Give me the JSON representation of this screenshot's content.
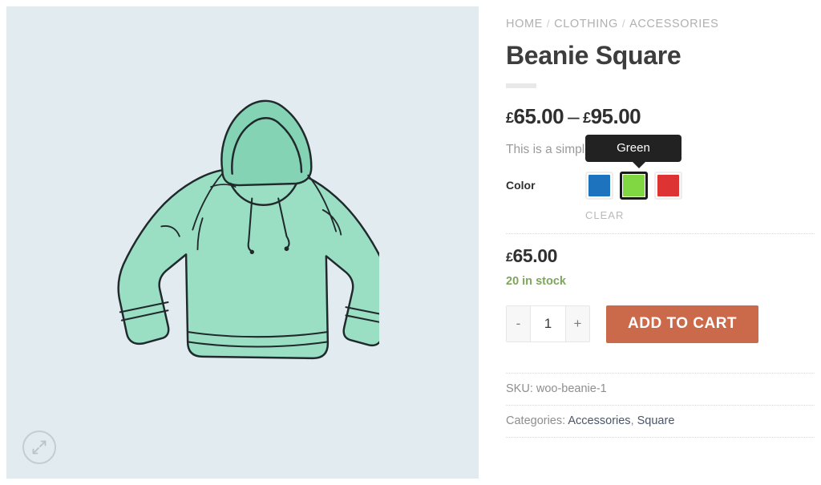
{
  "gallery": {
    "background_color": "#e1ebf0",
    "product_image_alt": "Green hoodie illustration",
    "zoom_button_name": "expand-image",
    "hoodie_fill_color": "#9adfc4",
    "hoodie_shade_color": "#84d3b5",
    "hoodie_outline_color": "#1f2a2a"
  },
  "breadcrumb": {
    "items": [
      {
        "label": "HOME"
      },
      {
        "label": "CLOTHING"
      },
      {
        "label": "ACCESSORIES"
      }
    ],
    "separator": "/"
  },
  "product": {
    "title": "Beanie Square",
    "price_range": {
      "currency": "£",
      "min": "65.00",
      "max": "95.00",
      "dash": "–"
    },
    "short_description": "This is a simple product.",
    "selected_price": {
      "currency": "£",
      "amount": "65.00"
    },
    "stock_status": "20 in stock",
    "stock_color": "#7ea55c"
  },
  "variations": {
    "attribute_label": "Color",
    "tooltip": "Green",
    "clear_label": "CLEAR",
    "swatches": [
      {
        "name": "Blue",
        "color": "#1e73be",
        "selected": false
      },
      {
        "name": "Green",
        "color": "#81d742",
        "selected": true
      },
      {
        "name": "Red",
        "color": "#dd3333",
        "selected": false
      }
    ]
  },
  "cart": {
    "quantity_value": "1",
    "decrement_label": "-",
    "increment_label": "+",
    "add_to_cart_label": "ADD TO CART",
    "button_color": "#cb6a4a"
  },
  "meta": {
    "sku_label": "SKU:",
    "sku_value": "woo-beanie-1",
    "categories_label": "Categories:",
    "categories": [
      {
        "label": "Accessories"
      },
      {
        "label": "Square"
      }
    ],
    "categories_separator": ","
  }
}
